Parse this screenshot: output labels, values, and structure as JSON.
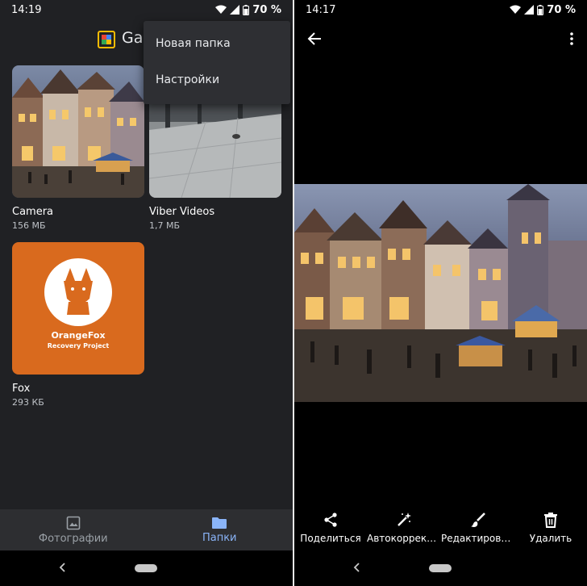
{
  "left": {
    "status": {
      "time": "14:19",
      "battery": "70 %"
    },
    "app_title": "Gal",
    "menu": {
      "items": [
        "Новая папка",
        "Настройки"
      ]
    },
    "folders": [
      {
        "name": "Camera",
        "size": "156 МБ"
      },
      {
        "name": "Viber Videos",
        "size": "1,7 МБ"
      },
      {
        "name": "Fox",
        "size": "293 КБ",
        "logo_title": "OrangeFox",
        "logo_subtitle": "Recovery Project"
      }
    ],
    "tabs": [
      {
        "label": "Фотографии",
        "icon": "photo-icon",
        "active": false
      },
      {
        "label": "Папки",
        "icon": "folder-icon",
        "active": true
      }
    ]
  },
  "right": {
    "status": {
      "time": "14:17",
      "battery": "70 %"
    },
    "actions": [
      {
        "label": "Поделиться",
        "icon": "share-icon"
      },
      {
        "label": "Автокоррекция",
        "icon": "magic-wand-icon"
      },
      {
        "label": "Редактировать",
        "icon": "brush-icon"
      },
      {
        "label": "Удалить",
        "icon": "trash-icon"
      }
    ]
  },
  "colors": {
    "background": "#202124",
    "accent": "#8ab4f8",
    "menu_bg": "#2e2f33",
    "fox_orange": "#d96a1e"
  }
}
